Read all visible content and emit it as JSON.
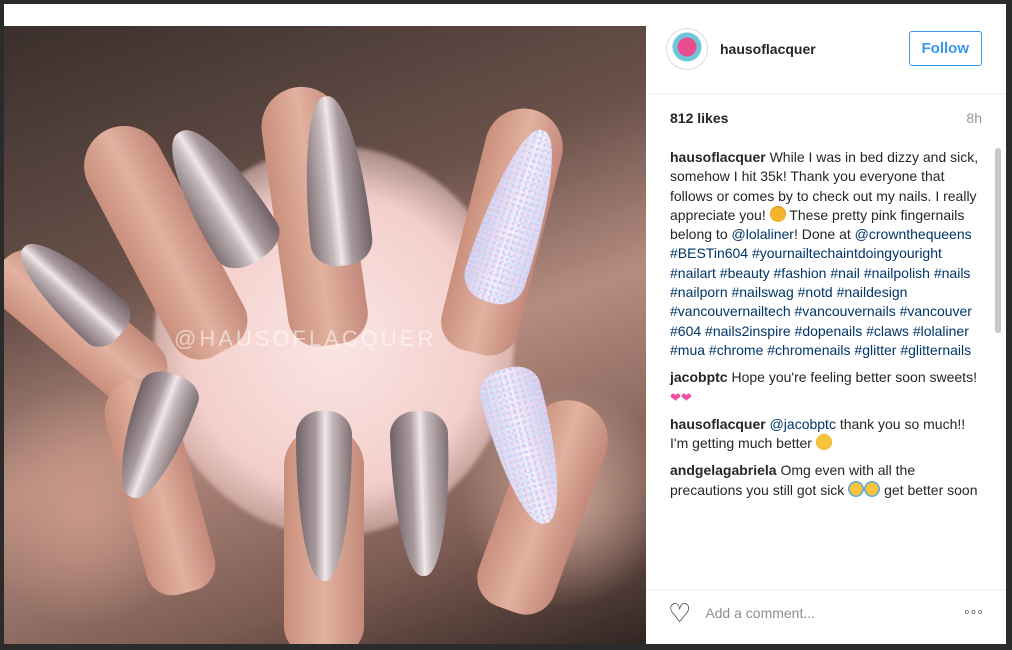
{
  "post": {
    "username": "hausoflacquer",
    "follow_label": "Follow",
    "likes": "812 likes",
    "time": "8h",
    "watermark": "@HAUSOFLACQUER"
  },
  "comments": [
    {
      "author": "hausoflacquer",
      "parts": [
        {
          "t": "text",
          "v": " While I was in bed dizzy and sick, somehow I hit 35k! Thank you everyone that follows or comes by to check out my nails. I really appreciate you! "
        },
        {
          "t": "emoji",
          "v": "heart-eyes"
        },
        {
          "t": "text",
          "v": " These pretty pink fingernails belong to "
        },
        {
          "t": "link",
          "v": "@lolaliner"
        },
        {
          "t": "text",
          "v": "! Done at "
        },
        {
          "t": "link",
          "v": "@crownthequeens"
        },
        {
          "t": "text",
          "v": " "
        },
        {
          "t": "link",
          "v": "#BESTin604"
        },
        {
          "t": "text",
          "v": " "
        },
        {
          "t": "link",
          "v": "#yournailtechaintdoingyouright #nailart #beauty #fashion #nail #nailpolish #nails #nailporn #nailswag #notd #naildesign #vancouvernailtech #vancouvernails #vancouver #604 #nails2inspire #dopenails #claws #lolaliner #mua #chrome #chromenails #glitter #glitternails"
        }
      ]
    },
    {
      "author": "jacobptc",
      "parts": [
        {
          "t": "text",
          "v": " Hope you're feeling better soon sweets! "
        },
        {
          "t": "emoji",
          "v": "hearts"
        }
      ]
    },
    {
      "author": "hausoflacquer",
      "parts": [
        {
          "t": "text",
          "v": " "
        },
        {
          "t": "link",
          "v": "@jacobptc"
        },
        {
          "t": "text",
          "v": " thank you so much!! I'm getting much better "
        },
        {
          "t": "emoji",
          "v": "smile"
        }
      ]
    },
    {
      "author": "andgelagabriela",
      "parts": [
        {
          "t": "text",
          "v": " Omg even with all the precautions you still got sick "
        },
        {
          "t": "emoji",
          "v": "cry"
        },
        {
          "t": "emoji",
          "v": "cry"
        },
        {
          "t": "text",
          "v": " get better soon"
        }
      ]
    }
  ],
  "footer": {
    "placeholder": "Add a comment..."
  },
  "icons": {
    "like": "heart-outline-icon",
    "more": "more-options-icon"
  },
  "colors": {
    "accent": "#3897f0",
    "link": "#003569",
    "text": "#262626",
    "muted": "#999999"
  }
}
